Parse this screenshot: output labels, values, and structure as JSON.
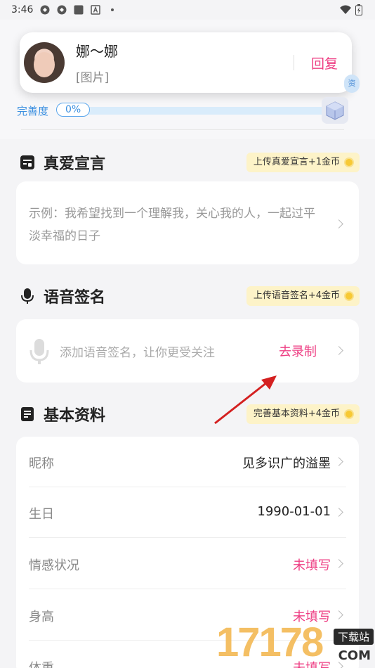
{
  "status_bar": {
    "time": "3:46"
  },
  "notification": {
    "name": "娜～娜",
    "message": "[图片]",
    "reply_label": "回复"
  },
  "side_badge": "资",
  "completeness": {
    "label": "完善度",
    "percent_text": "0%",
    "percent": 0
  },
  "declaration": {
    "title": "真爱宣言",
    "reward": "上传真爱宣言+1金币",
    "example_text": "示例：我希望找到一个理解我，关心我的人，一起过平淡幸福的日子"
  },
  "voice": {
    "title": "语音签名",
    "reward": "上传语音签名+4金币",
    "placeholder": "添加语音签名，让你更受关注",
    "record_label": "去录制"
  },
  "basic": {
    "title": "基本资料",
    "reward": "完善基本资料+4金币",
    "rows": [
      {
        "key": "昵称",
        "value": "见多识广的溢墨",
        "highlight": false
      },
      {
        "key": "生日",
        "value": "1990-01-01",
        "highlight": false
      },
      {
        "key": "情感状况",
        "value": "未填写",
        "highlight": true
      },
      {
        "key": "身高",
        "value": "未填写",
        "highlight": true
      },
      {
        "key": "体重",
        "value": "未填写",
        "highlight": true
      }
    ]
  },
  "watermark": {
    "digits": "17178",
    "tag": "下载站",
    "domain": "COM"
  },
  "colors": {
    "accent_pink": "#ee3e83",
    "accent_blue": "#3a8fe0",
    "reward_bg": "#fdf3c8"
  }
}
